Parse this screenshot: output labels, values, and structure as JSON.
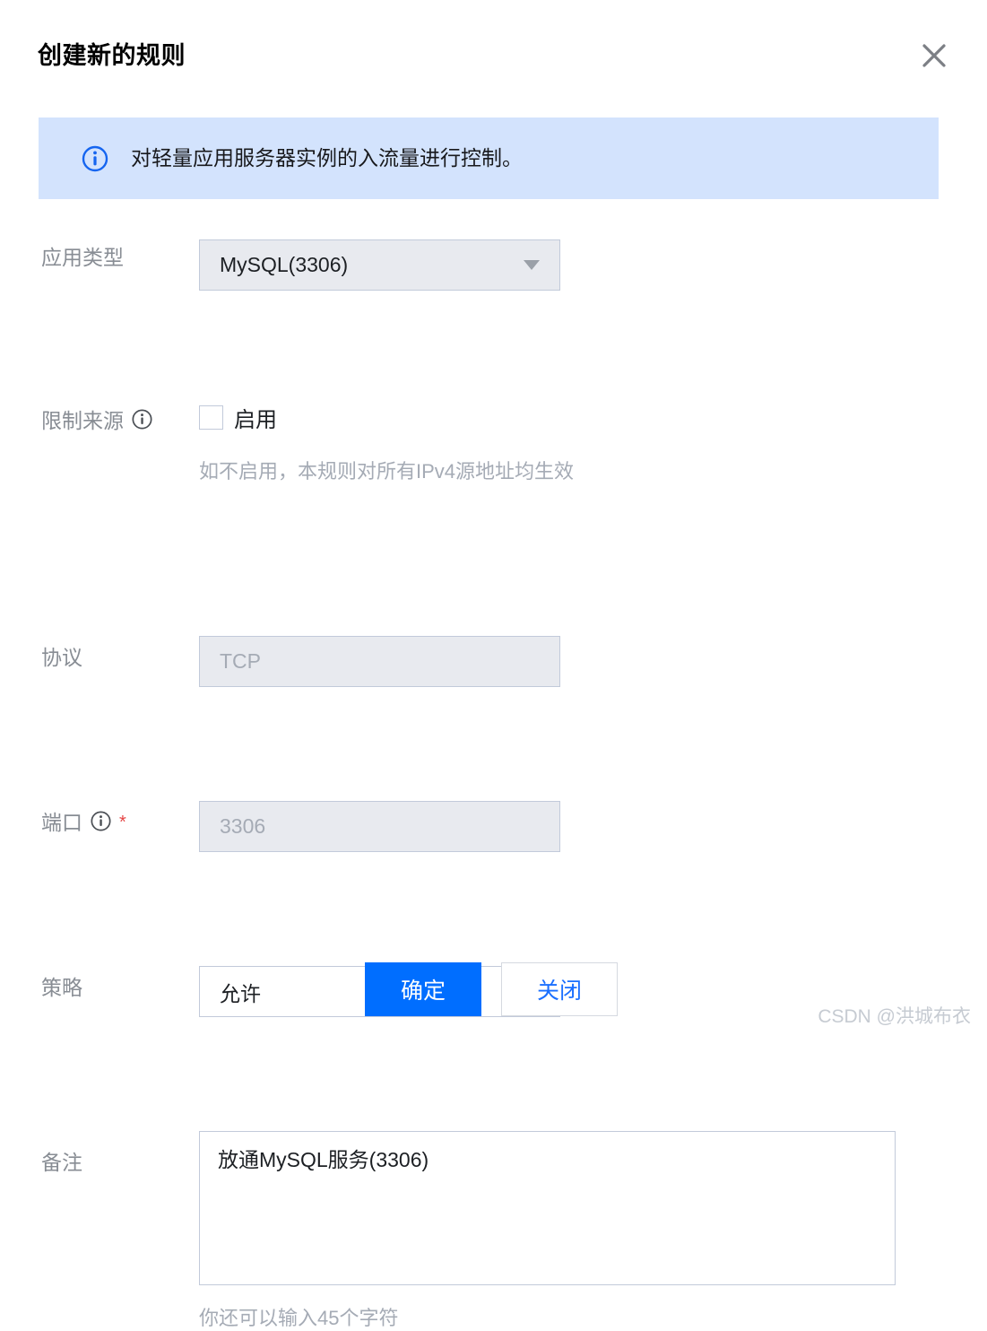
{
  "dialog": {
    "title": "创建新的规则",
    "close_icon": "close-icon"
  },
  "banner": {
    "icon": "info-circle-icon",
    "text": "对轻量应用服务器实例的入流量进行控制。"
  },
  "form": {
    "app_type": {
      "label": "应用类型",
      "value": "MySQL(3306)",
      "caret_icon": "chevron-down-icon"
    },
    "source_limit": {
      "label": "限制来源",
      "info_icon": "info-circle-icon",
      "checkbox_label": "启用",
      "checked": false,
      "hint": "如不启用，本规则对所有IPv4源地址均生效"
    },
    "protocol": {
      "label": "协议",
      "value": "",
      "placeholder": "TCP",
      "disabled": true
    },
    "port": {
      "label": "端口",
      "info_icon": "info-circle-icon",
      "required_mark": "*",
      "value": "",
      "placeholder": "3306",
      "disabled": true
    },
    "policy": {
      "label": "策略",
      "value": "允许",
      "caret_icon": "chevron-down-icon"
    },
    "remark": {
      "label": "备注",
      "value": "放通MySQL服务(3306)",
      "counter": "你还可以输入45个字符"
    }
  },
  "footer": {
    "confirm_label": "确定",
    "close_label": "关闭"
  },
  "watermark": {
    "text": "CSDN @洪城布衣"
  },
  "colors": {
    "primary": "#006eff",
    "banner_bg": "#d3e3fd",
    "disabled_bg": "#e8eaef",
    "border": "#c2cada",
    "label": "#888d94",
    "required": "#e54545"
  }
}
